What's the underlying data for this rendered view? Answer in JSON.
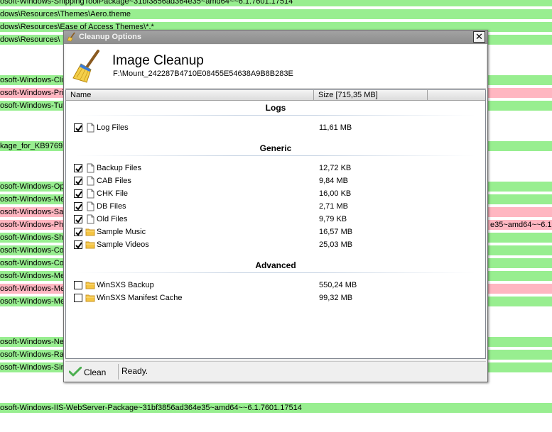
{
  "background_rows": [
    {
      "text": "osoft-Windows-SnippingToolPackage~31bf3856ad364e35~amd64~~6.1.7601.17514",
      "right": "",
      "color": "green"
    },
    {
      "text": "dows\\Resources\\Themes\\Aero.theme",
      "right": "",
      "color": "green"
    },
    {
      "text": "dows\\Resources\\Ease of Access Themes\\*.*",
      "right": "",
      "color": "green"
    },
    {
      "text": "dows\\Resources\\",
      "right": "",
      "color": "green"
    },
    {
      "text": "osoft-Windows-Clie",
      "right": "",
      "color": "green"
    },
    {
      "text": "osoft-Windows-Prin",
      "right": "",
      "color": "pink"
    },
    {
      "text": "osoft-Windows-Tuf",
      "right": "",
      "color": "green"
    },
    {
      "text": "kage_for_KB97693",
      "right": "",
      "color": "green"
    },
    {
      "text": "osoft-Windows-Op",
      "right": "",
      "color": "green"
    },
    {
      "text": "osoft-Windows-Me",
      "right": "",
      "color": "green"
    },
    {
      "text": "osoft-Windows-Sa",
      "right": "",
      "color": "pink"
    },
    {
      "text": "osoft-Windows-Pho",
      "right": "e35~amd64~~6.1.",
      "color": "pink"
    },
    {
      "text": "osoft-Windows-Sho",
      "right": "",
      "color": "green"
    },
    {
      "text": "osoft-Windows-Co",
      "right": "",
      "color": "green"
    },
    {
      "text": "osoft-Windows-Co",
      "right": "",
      "color": "green"
    },
    {
      "text": "osoft-Windows-Me",
      "right": "",
      "color": "green"
    },
    {
      "text": "osoft-Windows-Me",
      "right": "",
      "color": "pink"
    },
    {
      "text": "osoft-Windows-Me",
      "right": "",
      "color": "green"
    },
    {
      "text": "osoft-Windows-Ne",
      "right": "",
      "color": "green"
    },
    {
      "text": "osoft-Windows-Ra",
      "right": "",
      "color": "green"
    },
    {
      "text": "osoft-Windows-Sim",
      "right": "",
      "color": "green"
    },
    {
      "text": "osoft-Windows-IIS-WebServer-Package~31bf3856ad364e35~amd64~~6.1.7601.17514",
      "right": "",
      "color": "green"
    }
  ],
  "dialog": {
    "title": "Cleanup Options",
    "close_glyph": "✕",
    "header": {
      "title": "Image Cleanup",
      "path": "F:\\Mount_242287B4710E08455E54638A9B8B283E"
    },
    "columns": {
      "name": "Name",
      "size": "Size [715,35 MB]",
      "extra": ""
    },
    "groups": [
      {
        "title": "Logs",
        "items": [
          {
            "label": "Log Files",
            "size": "11,61 MB",
            "checked": true,
            "icon": "file-icon"
          }
        ]
      },
      {
        "title": "Generic",
        "items": [
          {
            "label": "Backup Files",
            "size": "12,72 KB",
            "checked": true,
            "icon": "file-icon"
          },
          {
            "label": "CAB Files",
            "size": "9,84 MB",
            "checked": true,
            "icon": "file-icon"
          },
          {
            "label": "CHK File",
            "size": "16,00 KB",
            "checked": true,
            "icon": "file-icon"
          },
          {
            "label": "DB Files",
            "size": "2,71 MB",
            "checked": true,
            "icon": "file-icon"
          },
          {
            "label": "Old Files",
            "size": "9,79 KB",
            "checked": true,
            "icon": "file-icon"
          },
          {
            "label": "Sample Music",
            "size": "16,57 MB",
            "checked": true,
            "icon": "folder-icon"
          },
          {
            "label": "Sample Videos",
            "size": "25,03 MB",
            "checked": true,
            "icon": "folder-icon"
          }
        ]
      },
      {
        "title": "Advanced",
        "items": [
          {
            "label": "WinSXS Backup",
            "size": "550,24 MB",
            "checked": false,
            "icon": "folder-icon"
          },
          {
            "label": "WinSXS Manifest Cache",
            "size": "99,32 MB",
            "checked": false,
            "icon": "folder-icon"
          }
        ]
      }
    ],
    "statusbar": {
      "clean_label": "Clean",
      "status": "Ready."
    }
  },
  "colors": {
    "row_green": "#98ee90",
    "row_pink": "#ffb6c1",
    "titlebar": "#8c8c8c",
    "folder": "#f5c542"
  }
}
